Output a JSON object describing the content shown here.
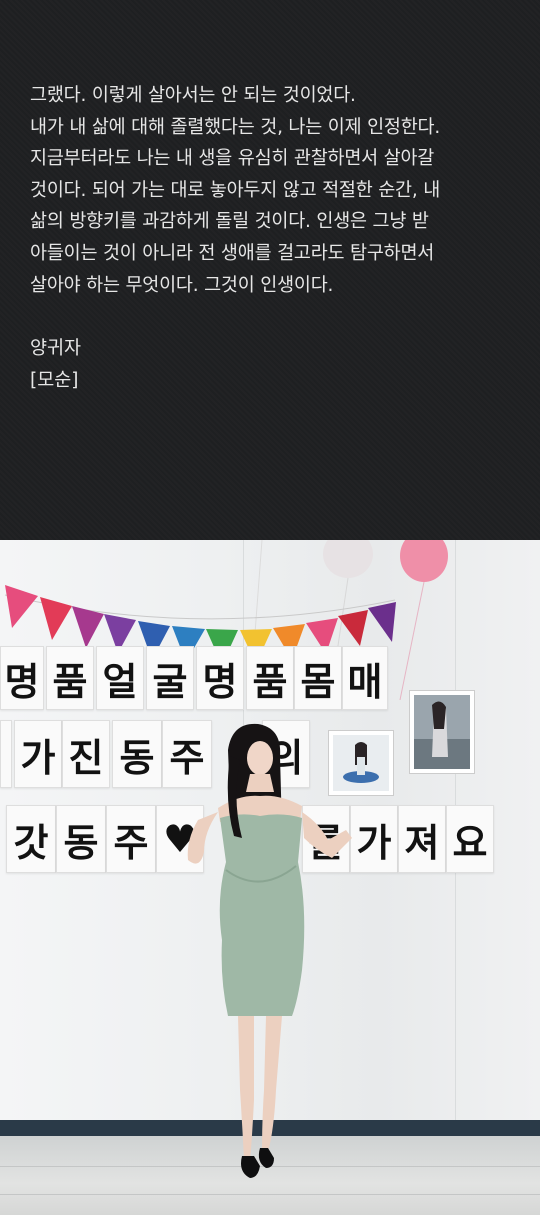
{
  "post": {
    "lines": [
      "그랬다. 이렇게 살아서는 안 되는 것이었다.",
      "내가 내 삶에 대해 졸렬했다는 것, 나는 이제 인정한다.",
      "지금부터라도 나는 내 생을 유심히 관찰하면서 살아갈",
      "것이다. 되어 가는 대로 놓아두지 않고 적절한 순간, 내",
      "삶의 방향키를 과감하게 돌릴 것이다. 인생은 그냥 받",
      "아들이는 것이 아니라 전 생애를 걸고라도 탐구하면서",
      "살아야 하는 무엇이다. 그것이 인생이다."
    ],
    "author": "양귀자",
    "source": "[모순]"
  },
  "photo": {
    "sign_row1": [
      "명",
      "품",
      "얼",
      "굴",
      "명",
      "품",
      "몸",
      "매"
    ],
    "sign_row2": [
      "가",
      "진",
      "동",
      "주",
      "의"
    ],
    "sign_row3_left": [
      "갓",
      "동",
      "주"
    ],
    "sign_row3_right": [
      "를",
      "가",
      "져",
      "요"
    ],
    "colors": {
      "dress": "#9fb8a6",
      "baseboard": "#2a3a48",
      "pennants": [
        "#e64d7d",
        "#e23b57",
        "#a6398e",
        "#7b3fa0",
        "#2f5fb0",
        "#2d7fc1",
        "#3aa64a",
        "#f2c230",
        "#f08a2a",
        "#e64d7d",
        "#c92a3b",
        "#6b2f8c"
      ]
    }
  }
}
